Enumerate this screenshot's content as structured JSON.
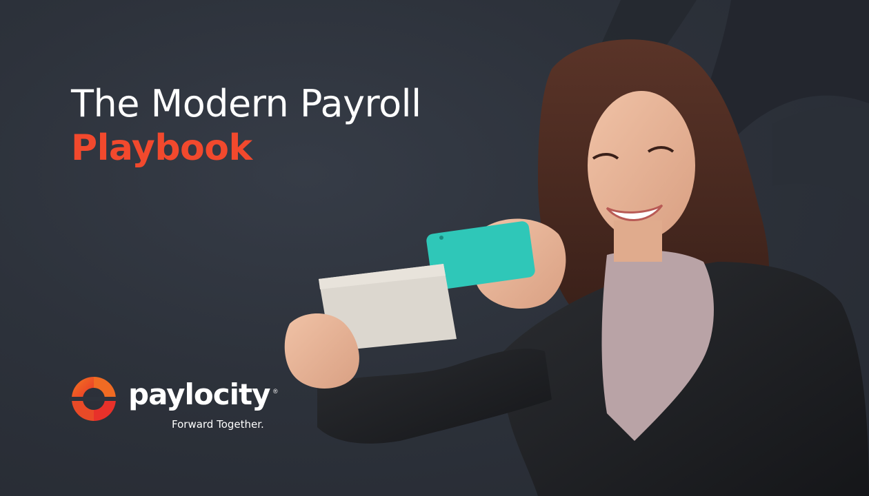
{
  "headline": {
    "line1": "The Modern Payroll",
    "line2": "Playbook"
  },
  "brand": {
    "name": "paylocity",
    "registered": "®",
    "tagline": "Forward Together."
  },
  "colors": {
    "background": "#2d323b",
    "accent": "#f2492d",
    "text": "#ffffff",
    "phone": "#2fc7b8",
    "logo_gradient_start": "#f05a28",
    "logo_gradient_end": "#e8312a"
  },
  "photo": {
    "subject": "woman-smiling-photographing-check-with-phone"
  }
}
